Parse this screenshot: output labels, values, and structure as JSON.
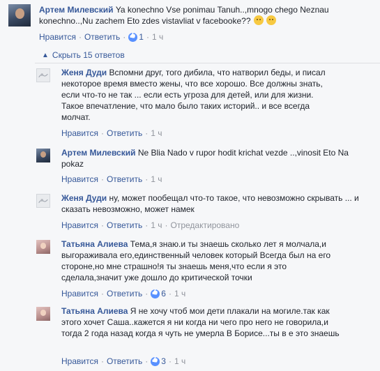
{
  "comments": [
    {
      "author": "Артем Милевский",
      "text": "Ya konechno Vse ponimau Tanuh..,mnogo chego Neznau konechno..,Nu zachem Eto zdes vistavliat v facebooke??",
      "emoji": [
        "😏",
        "😳"
      ],
      "like_label": "Нравится",
      "reply_label": "Ответить",
      "likes": "1",
      "time": "1 ч"
    }
  ],
  "hide_replies": "Скрыть 15 ответов",
  "replies": [
    {
      "author": "Женя Дуди",
      "text": "Вспомни друг, того дибила, что натворил беды, и писал некоторое время вместо жены, что все хорошо. Все должны знать, если что-то не так ... если есть угроза для детей, или для жизни. Такое впечатление, что мало было таких историй.. и все всегда молчат.",
      "like_label": "Нравится",
      "reply_label": "Ответить",
      "time": "1 ч"
    },
    {
      "author": "Артем Милевский",
      "text": "Ne Blia Nado v rupor hodit krichat vezde ..,vinosit Eto Na pokaz",
      "like_label": "Нравится",
      "reply_label": "Ответить",
      "time": "1 ч"
    },
    {
      "author": "Женя Дуди",
      "text": "ну, может пообещал что-то такое, что невозможно скрывать ... и сказать невозможно, может намек",
      "like_label": "Нравится",
      "reply_label": "Ответить",
      "time": "1 ч",
      "edited": "Отредактировано"
    },
    {
      "author": "Татьяна Алиева",
      "text": "Тема,я знаю.и ты знаешь сколько лет я молчала,и выгораживала его,единственный человек который Всегда был на его стороне,но мне страшно!я ты знаешь меня,что если я это сделала,значит уже дошло до критической точки",
      "like_label": "Нравится",
      "reply_label": "Ответить",
      "likes": "6",
      "time": "1 ч"
    },
    {
      "author": "Татьяна Алиева",
      "text": "Я не хочу чтоб мои дети плакали на могиле.так как этого хочет Саша..кажется я ни когда ни чего про него не говорила,и тогда 2 года назад когда я чуть не умерла В Борисе...ты в е это знаешь",
      "like_label": "Нравится",
      "reply_label": "Ответить",
      "likes": "3",
      "time": "1 ч"
    }
  ],
  "colors": {
    "link": "#365899",
    "meta": "#90949c",
    "text": "#1d2129",
    "background": "#f6f7f9"
  }
}
